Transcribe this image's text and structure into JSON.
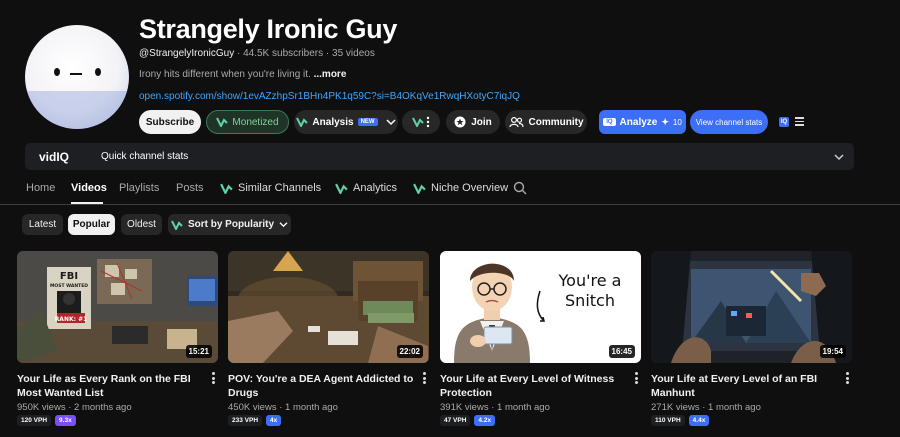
{
  "channel": {
    "name": "Strangely Ironic Guy",
    "handle": "@StrangelyIronicGuy",
    "subscribers": "44.5K subscribers",
    "videos": "35 videos",
    "description": "Irony hits different when you're living it.",
    "more_label": "...more",
    "link": "open.spotify.com/show/1evAZzhpSr1BHn4PK1q59C?si=B4OKqVe1RwqHXotyC7iqJQ"
  },
  "actions": {
    "subscribe": "Subscribe",
    "monetized": "Monetized",
    "analysis": "Analysis",
    "analysis_badge": "NEW",
    "join": "Join",
    "community": "Community",
    "analyze": "Analyze",
    "analyze_count": "10",
    "view_stats": "View channel stats",
    "vidiq_square": "IQ"
  },
  "vidiq_bar": {
    "logo": "vidIQ",
    "label": "Quick channel stats"
  },
  "tabs": [
    {
      "label": "Home",
      "active": false
    },
    {
      "label": "Videos",
      "active": true
    },
    {
      "label": "Playlists",
      "active": false
    },
    {
      "label": "Posts",
      "active": false
    },
    {
      "label": "Similar Channels",
      "active": false
    },
    {
      "label": "Analytics",
      "active": false
    },
    {
      "label": "Niche Overview",
      "active": false
    }
  ],
  "filters": {
    "latest": "Latest",
    "popular": "Popular",
    "oldest": "Oldest",
    "sort": "Sort by Popularity",
    "selected": "Popular"
  },
  "videos": [
    {
      "title": "Your Life as Every Rank on the FBI Most Wanted List",
      "duration": "15:21",
      "views": "950K views",
      "age": "2 months ago",
      "vph": "120 VPH",
      "multiplier": "9.3x",
      "mult_color": "#7c4dff"
    },
    {
      "title": "POV: You're a DEA Agent Addicted to Drugs",
      "duration": "22:02",
      "views": "450K views",
      "age": "1 month ago",
      "vph": "233 VPH",
      "multiplier": "4x",
      "mult_color": "#3d6ef7"
    },
    {
      "title": "Your Life at Every Level of Witness Protection",
      "duration": "16:45",
      "views": "391K views",
      "age": "1 month ago",
      "vph": "47 VPH",
      "multiplier": "4.2x",
      "mult_color": "#3d6ef7"
    },
    {
      "title": "Your Life at Every Level of an FBI Manhunt",
      "duration": "19:54",
      "views": "271K views",
      "age": "1 month ago",
      "vph": "110 VPH",
      "multiplier": "4.4x",
      "mult_color": "#3d6ef7"
    }
  ],
  "thumbnail_text": {
    "t1_sign_top": "FBI",
    "t1_sign_sub": "MOST WANTED",
    "t1_rank": "RANK: #1",
    "t3_caption_line1": "You're a",
    "t3_caption_line2": "Snitch"
  },
  "colors": {
    "background": "#0f0f0f",
    "accent_blue": "#3d6ef7",
    "link": "#3ea6ff",
    "monetized_green": "#7fd39b"
  }
}
